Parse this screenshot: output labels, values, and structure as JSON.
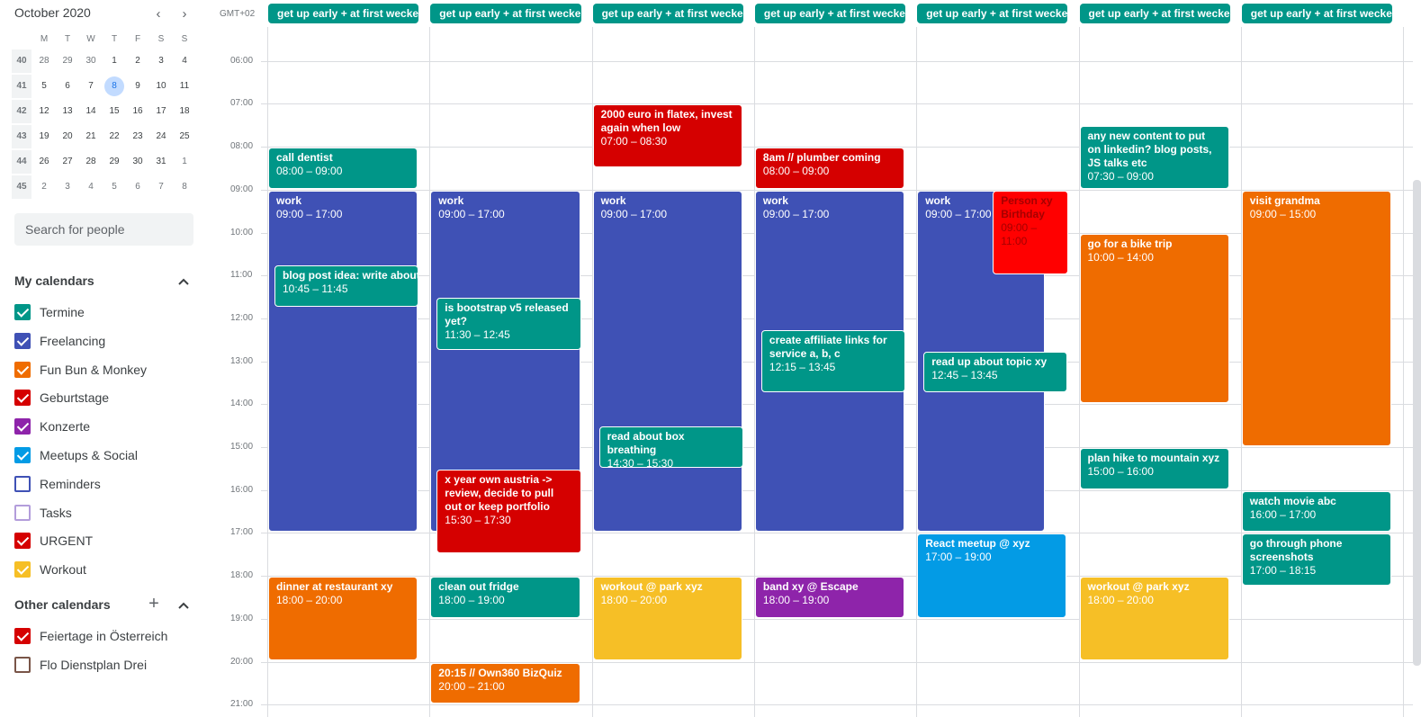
{
  "mini_calendar": {
    "title": "October 2020",
    "prev_icon": "‹",
    "next_icon": "›",
    "dow": [
      "M",
      "T",
      "W",
      "T",
      "F",
      "S",
      "S"
    ],
    "weeks": [
      {
        "wk": "40",
        "days": [
          "28",
          "29",
          "30",
          "1",
          "2",
          "3",
          "4"
        ]
      },
      {
        "wk": "41",
        "days": [
          "5",
          "6",
          "7",
          "8",
          "9",
          "10",
          "11"
        ]
      },
      {
        "wk": "42",
        "days": [
          "12",
          "13",
          "14",
          "15",
          "16",
          "17",
          "18"
        ]
      },
      {
        "wk": "43",
        "days": [
          "19",
          "20",
          "21",
          "22",
          "23",
          "24",
          "25"
        ]
      },
      {
        "wk": "44",
        "days": [
          "26",
          "27",
          "28",
          "29",
          "30",
          "31",
          "1"
        ]
      },
      {
        "wk": "45",
        "days": [
          "2",
          "3",
          "4",
          "5",
          "6",
          "7",
          "8"
        ]
      }
    ]
  },
  "search": {
    "placeholder": "Search for people"
  },
  "my_calendars": {
    "title": "My calendars",
    "items": [
      {
        "label": "Termine",
        "color": "#009688",
        "checked": true
      },
      {
        "label": "Freelancing",
        "color": "#3f51b5",
        "checked": true
      },
      {
        "label": "Fun Bun & Monkey",
        "color": "#ef6c00",
        "checked": true
      },
      {
        "label": "Geburtstage",
        "color": "#d50000",
        "checked": true
      },
      {
        "label": "Konzerte",
        "color": "#8e24aa",
        "checked": true
      },
      {
        "label": "Meetups & Social",
        "color": "#039be5",
        "checked": true
      },
      {
        "label": "Reminders",
        "color": "#3f51b5",
        "checked": false
      },
      {
        "label": "Tasks",
        "color": "#b39ddb",
        "checked": false
      },
      {
        "label": "URGENT",
        "color": "#d50000",
        "checked": true
      },
      {
        "label": "Workout",
        "color": "#f6bf26",
        "checked": true
      }
    ]
  },
  "other_calendars": {
    "title": "Other calendars",
    "add_icon": "+",
    "items": [
      {
        "label": "Feiertage in Österreich",
        "color": "#d50000",
        "checked": true
      },
      {
        "label": "Flo Dienstplan Drei",
        "color": "#795548",
        "checked": false
      }
    ]
  },
  "grid": {
    "timezone": "GMT+02",
    "hours": [
      "06:00",
      "07:00",
      "08:00",
      "09:00",
      "10:00",
      "11:00",
      "12:00",
      "13:00",
      "14:00",
      "15:00",
      "16:00",
      "17:00",
      "18:00",
      "19:00",
      "20:00",
      "21:00"
    ],
    "allday_title": "get up early + at first wecker",
    "allday_color": "#009688"
  },
  "colors": {
    "termine": "#009688",
    "freelancing": "#3f51b5",
    "fun": "#ef6c00",
    "urgent": "#d50000",
    "konzerte": "#8e24aa",
    "meetups": "#039be5",
    "workout": "#f6bf26",
    "birthday": "#ff0000"
  },
  "events": [
    {
      "day": 0,
      "title": "call dentist",
      "time": "08:00 – 09:00",
      "color": "termine"
    },
    {
      "day": 0,
      "title": "work",
      "time": "09:00 – 17:00",
      "color": "freelancing"
    },
    {
      "day": 0,
      "title": "blog post idea: write about c",
      "time": "10:45 – 11:45",
      "color": "termine"
    },
    {
      "day": 0,
      "title": "dinner at restaurant xy",
      "time": "18:00 – 20:00",
      "color": "fun"
    },
    {
      "day": 1,
      "title": "work",
      "time": "09:00 – 17:00",
      "color": "freelancing"
    },
    {
      "day": 1,
      "title": "is bootstrap v5 released yet?",
      "time": "11:30 – 12:45",
      "color": "termine"
    },
    {
      "day": 1,
      "title": "x year own austria -> review, decide to pull out or keep portfolio",
      "time": "15:30 – 17:30",
      "color": "urgent"
    },
    {
      "day": 1,
      "title": "clean out fridge",
      "time": "18:00 – 19:00",
      "color": "termine"
    },
    {
      "day": 1,
      "title": "20:15 // Own360 BizQuiz",
      "time": "20:00 – 21:00",
      "color": "fun"
    },
    {
      "day": 2,
      "title": "2000 euro in flatex, invest again when low",
      "time": "07:00 – 08:30",
      "color": "urgent"
    },
    {
      "day": 2,
      "title": "work",
      "time": "09:00 – 17:00",
      "color": "freelancing"
    },
    {
      "day": 2,
      "title": "read about box breathing",
      "time": "14:30 – 15:30",
      "color": "termine"
    },
    {
      "day": 2,
      "title": "workout @ park xyz",
      "time": "18:00 – 20:00",
      "color": "workout"
    },
    {
      "day": 3,
      "title": "8am // plumber coming",
      "time": "08:00 – 09:00",
      "color": "urgent"
    },
    {
      "day": 3,
      "title": "work",
      "time": "09:00 – 17:00",
      "color": "freelancing"
    },
    {
      "day": 3,
      "title": "create affiliate links for service a, b, c",
      "time": "12:15 – 13:45",
      "color": "termine"
    },
    {
      "day": 3,
      "title": "band xy @ Escape",
      "time": "18:00 – 19:00",
      "color": "konzerte"
    },
    {
      "day": 4,
      "title": "work",
      "time": "09:00 – 17:00",
      "color": "freelancing"
    },
    {
      "day": 4,
      "title": "Person xy Birthday",
      "time": "09:00 – 11:00",
      "color": "birthday"
    },
    {
      "day": 4,
      "title": "read up about topic xy",
      "time": "12:45 – 13:45",
      "color": "termine"
    },
    {
      "day": 4,
      "title": "React meetup @ xyz",
      "time": "17:00 – 19:00",
      "color": "meetups"
    },
    {
      "day": 5,
      "title": "any new content to put on linkedin? blog posts, JS talks etc",
      "time": "07:30 – 09:00",
      "color": "termine"
    },
    {
      "day": 5,
      "title": "go for a bike trip",
      "time": "10:00 – 14:00",
      "color": "fun"
    },
    {
      "day": 5,
      "title": "plan hike to mountain xyz",
      "time": "15:00 – 16:00",
      "color": "termine"
    },
    {
      "day": 5,
      "title": "workout @ park xyz",
      "time": "18:00 – 20:00",
      "color": "workout"
    },
    {
      "day": 6,
      "title": "visit grandma",
      "time": "09:00 – 15:00",
      "color": "fun"
    },
    {
      "day": 6,
      "title": "watch movie abc",
      "time": "16:00 – 17:00",
      "color": "termine"
    },
    {
      "day": 6,
      "title": "go through phone screenshots",
      "time": "17:00 – 18:15",
      "color": "termine"
    }
  ]
}
